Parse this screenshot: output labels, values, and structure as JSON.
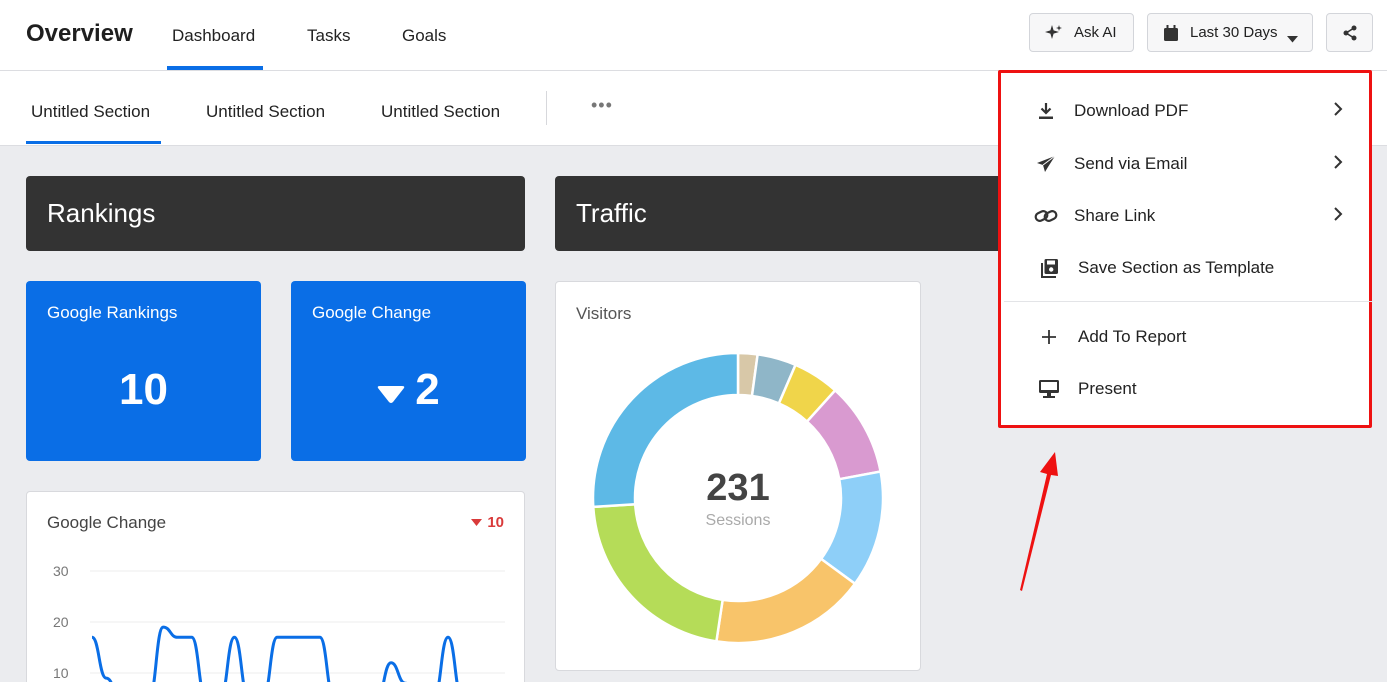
{
  "header": {
    "title": "Overview",
    "tabs": [
      "Dashboard",
      "Tasks",
      "Goals"
    ],
    "ask_ai": "Ask AI",
    "date_range": "Last 30 Days"
  },
  "sections": {
    "tabs": [
      "Untitled Section",
      "Untitled Section",
      "Untitled Section"
    ],
    "more": "•••"
  },
  "rankings": {
    "header": "Rankings",
    "google_rankings": {
      "title": "Google Rankings",
      "value": "10"
    },
    "google_change": {
      "title": "Google Change",
      "value": "2"
    },
    "chart_panel": {
      "title": "Google Change",
      "badge": "10"
    }
  },
  "traffic": {
    "header": "Traffic",
    "visitors": {
      "title": "Visitors",
      "center_value": "231",
      "center_label": "Sessions"
    }
  },
  "share_menu": {
    "items": [
      {
        "label": "Download PDF",
        "icon": "download-icon"
      },
      {
        "label": "Send via Email",
        "icon": "send-icon"
      },
      {
        "label": "Share Link",
        "icon": "link-icon"
      },
      {
        "label": "Save Section as Template",
        "icon": "save-icon"
      },
      {
        "label": "Add To Report",
        "icon": "plus-icon"
      },
      {
        "label": "Present",
        "icon": "monitor-icon"
      }
    ]
  },
  "colors": {
    "accent": "#0a6ee6",
    "header_dark": "#333333",
    "highlight": "#ee1111",
    "negative": "#d93a3a"
  },
  "chart_data": [
    {
      "type": "line",
      "title": "Google Change",
      "yticks": [
        10,
        20,
        30
      ],
      "ylim": [
        10,
        30
      ],
      "x": [
        0,
        1,
        2,
        3,
        4,
        5,
        6,
        7,
        8,
        9,
        10,
        11,
        12,
        13,
        14,
        15,
        16,
        17,
        18,
        19,
        20,
        21,
        22,
        23,
        24,
        25,
        26,
        27,
        28,
        29
      ],
      "values": [
        17,
        9,
        5,
        5,
        5,
        19,
        17,
        17,
        5,
        5,
        17,
        5,
        5,
        17,
        17,
        17,
        17,
        5,
        5,
        5,
        5,
        12,
        8,
        5,
        5,
        17,
        5,
        5,
        5,
        5
      ]
    },
    {
      "type": "pie",
      "title": "Visitors",
      "center_value": 231,
      "center_label": "Sessions",
      "values": [
        5,
        10,
        12,
        24,
        30,
        40,
        50,
        60
      ],
      "colors": [
        "#d8c8a8",
        "#8fb6c8",
        "#f0d54a",
        "#d99ad0",
        "#8ecff8",
        "#f8c46a",
        "#b5dc58",
        "#5db9e6"
      ]
    }
  ]
}
